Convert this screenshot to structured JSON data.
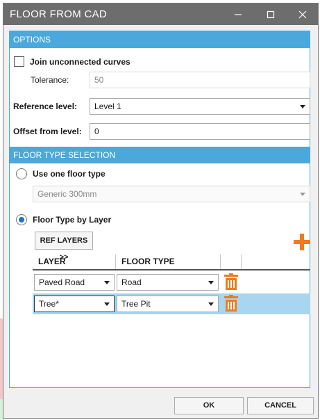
{
  "window": {
    "title": "FLOOR FROM CAD",
    "controls": {
      "minimize": "minimize",
      "maximize": "maximize",
      "close": "close"
    }
  },
  "options": {
    "header": "OPTIONS",
    "join_label": "Join unconnected curves",
    "join_checked": false,
    "tolerance_label": "Tolerance:",
    "tolerance_value": "50",
    "reference_level_label": "Reference level:",
    "reference_level_value": "Level 1",
    "offset_label": "Offset from level:",
    "offset_value": "0"
  },
  "floor_type_selection": {
    "header": "FLOOR TYPE SELECTION",
    "use_one_label": "Use one floor type",
    "use_one_value": "Generic 300mm",
    "by_layer_label": "Floor Type by Layer",
    "selected_mode": "by_layer",
    "ref_layers_button": "REF LAYERS >>",
    "columns": [
      "LAYER",
      "FLOOR TYPE"
    ],
    "rows": [
      {
        "layer": "Paved Road",
        "floor_type": "Road",
        "selected": false
      },
      {
        "layer": "Tree*",
        "floor_type": "Tree Pit",
        "selected": true
      }
    ],
    "accent_color": "#f07c1b"
  },
  "footer": {
    "ok_label": "OK",
    "cancel_label": "CANCEL"
  },
  "colors": {
    "titlebar": "#6d6d6d",
    "section_header": "#4aa8dc",
    "selected_row": "#a8d5f0"
  }
}
